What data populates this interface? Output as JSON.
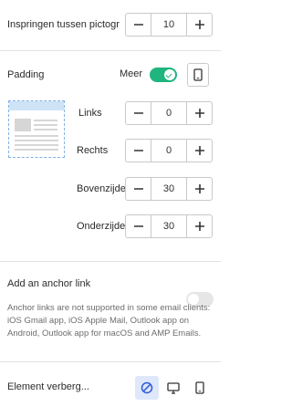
{
  "indent": {
    "label": "Inspringen tussen pictogr",
    "value": "10"
  },
  "padding": {
    "label": "Padding",
    "more_label": "Meer",
    "toggle_on": true,
    "rows": [
      {
        "label": "Links",
        "value": "0"
      },
      {
        "label": "Rechts",
        "value": "0"
      },
      {
        "label": "Bovenzijde",
        "value": "30"
      },
      {
        "label": "Onderzijde",
        "value": "30"
      }
    ]
  },
  "anchor": {
    "label": "Add an anchor link",
    "toggle_on": false,
    "note": "Anchor links are not supported in some email clients: iOS Gmail app, iOS Apple Mail, Outlook app on Android, Outlook app for macOS and AMP Emails."
  },
  "hide": {
    "label": "Element verberg..."
  },
  "colors": {
    "accent": "#1fb57e",
    "selected_bg": "#dfe7fb",
    "selected_icon": "#2f5bd6"
  }
}
